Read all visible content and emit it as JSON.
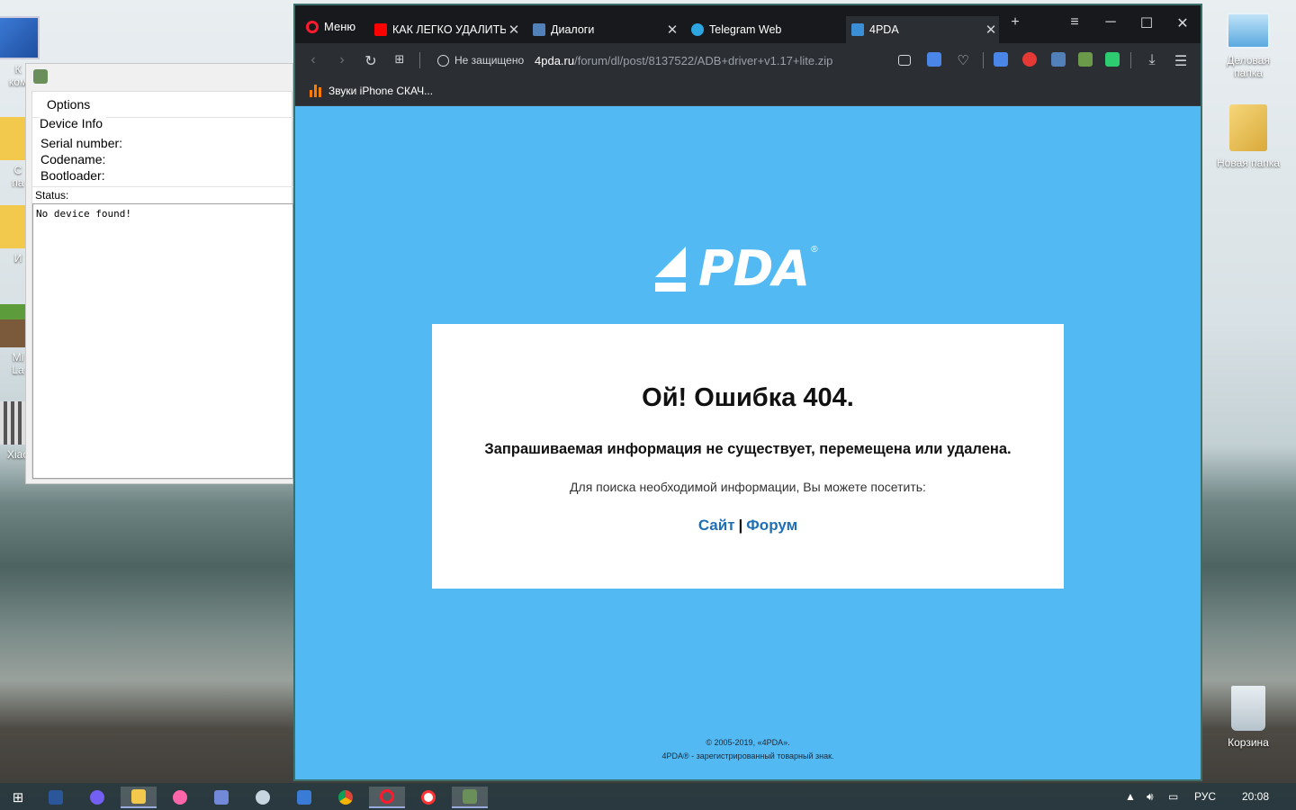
{
  "desktop": {
    "left_icons": [
      {
        "label": "К\nком",
        "icon": "computer-icon"
      },
      {
        "label": "С\nпа",
        "icon": "folder-icon"
      },
      {
        "label": "И",
        "icon": "folder-icon"
      },
      {
        "label": "Mi\nLa",
        "icon": "minecraft-icon"
      },
      {
        "label": "Xiao",
        "icon": "xiaomi-tool-icon"
      }
    ],
    "right_icons": [
      {
        "label": "Деловая папка",
        "icon": "monitor-icon"
      },
      {
        "label": "Новая папка",
        "icon": "folder-icon"
      },
      {
        "label": "Корзина",
        "icon": "recycle-bin-icon"
      }
    ]
  },
  "adb_app": {
    "tab_label": "Options",
    "device_info_legend": "Device Info",
    "serial_label": "Serial number:",
    "codename_label": "Codename:",
    "bootloader_label": "Bootloader:",
    "status_label": "Status:",
    "status_text": "No device found!"
  },
  "browser": {
    "menu_label": "Меню",
    "tabs": [
      {
        "title": "КАК ЛЕГКО УДАЛИТЬ",
        "icon": "youtube-icon",
        "color": "#ff0000"
      },
      {
        "title": "Диалоги",
        "icon": "chat-icon",
        "color": "#5181b8"
      },
      {
        "title": "Telegram Web",
        "icon": "telegram-icon",
        "color": "#2ca5e0"
      },
      {
        "title": "4PDA",
        "icon": "4pda-icon",
        "color": "#3b8fd6"
      }
    ],
    "security_label": "Не защищено",
    "url_host": "4pda.ru",
    "url_path": "/forum/dl/post/8137522/ADB+driver+v1.17+lite.zip",
    "bookmark_label": "Звуки iPhone СКАЧ..."
  },
  "page": {
    "logo_text": "PDA",
    "logo_mark": "®",
    "error_title": "Ой! Ошибка 404.",
    "error_subtitle": "Запрашиваемая информация не существует, перемещена или удалена.",
    "hint": "Для поиска необходимой информации, Вы можете посетить:",
    "link_site": "Сайт",
    "link_sep": "|",
    "link_forum": "Форум",
    "footer_line1": "© 2005-2019, «4PDA».",
    "footer_line2": "4PDA® - зарегистрированный товарный знак.",
    "colors": {
      "background": "#52b9f3",
      "link": "#1f6fb5"
    }
  },
  "taskbar": {
    "apps": [
      "start",
      "word",
      "viber",
      "explorer",
      "osu",
      "discord",
      "steam",
      "media",
      "chrome",
      "opera",
      "yandex",
      "app"
    ],
    "language": "РУС",
    "time": "20:08"
  }
}
